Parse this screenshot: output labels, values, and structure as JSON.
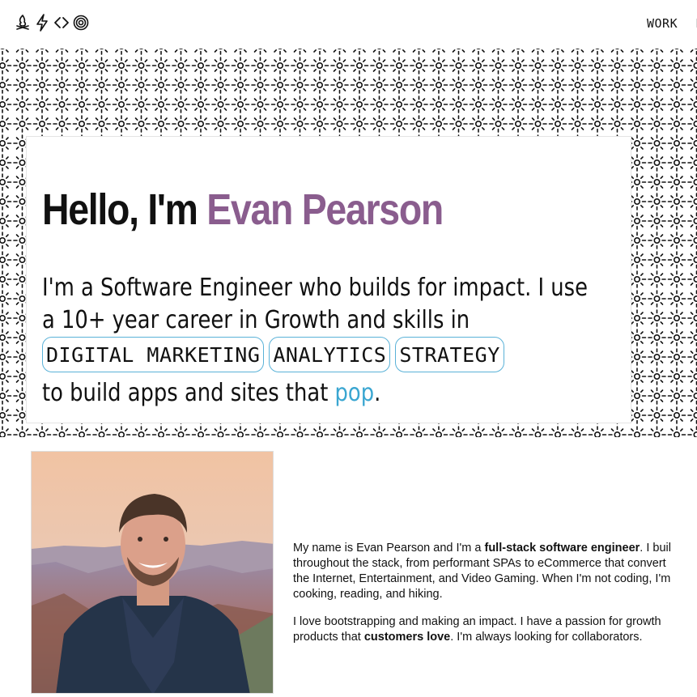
{
  "nav": {
    "logo_icons": [
      "campfire-icon",
      "lightning-icon",
      "code-brackets-icon",
      "target-icon"
    ],
    "links": [
      "WORK",
      "F"
    ]
  },
  "hero": {
    "greeting": "Hello, I'm ",
    "name": "Evan Pearson",
    "line1": "I'm a Software Engineer who builds for impact. I use",
    "line2": "a 10+ year career in Growth and skills in",
    "tags": [
      "DIGITAL MARKETING",
      "ANALYTICS",
      "STRATEGY"
    ],
    "line4_prefix": "to build apps and sites that ",
    "line4_link": "pop",
    "line4_suffix": "."
  },
  "about": {
    "p1": {
      "a": "My name is Evan Pearson and I'm a ",
      "b": "full-stack software engineer",
      "c": ". I buil",
      "line2": "throughout the stack, from performant SPAs to eCommerce that convert",
      "line3": "the Internet, Entertainment, and Video Gaming. When I'm not coding, I'm",
      "line4": "cooking, reading, and hiking."
    },
    "p2": {
      "line1": "I love bootstrapping and making an impact. I have a passion for growth",
      "a": "products that ",
      "b": "customers love",
      "c": ". I'm always looking for collaborators."
    }
  },
  "colors": {
    "name_accent": "#8a5d8e",
    "link_accent": "#3aa6d1",
    "tag_border": "#5ab2d8",
    "pattern": "#111111"
  }
}
